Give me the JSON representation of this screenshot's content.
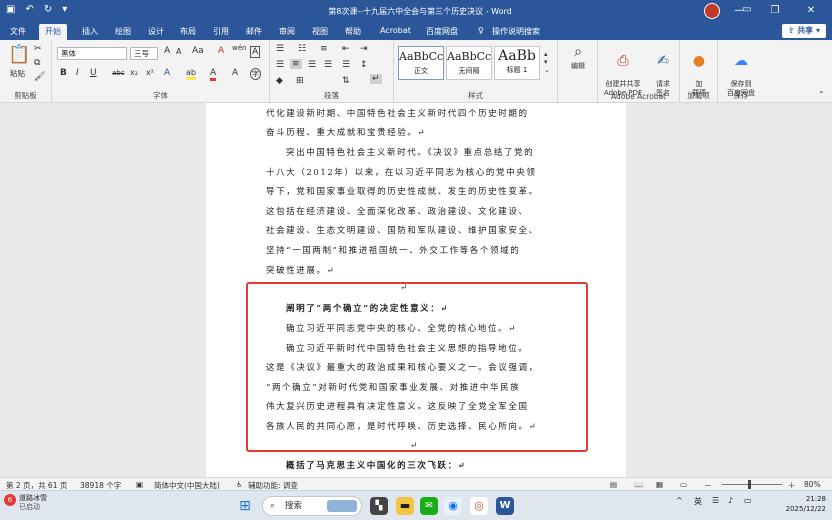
{
  "window": {
    "title": "第8次课--十九届六中全会与第三个历史决议 - Word",
    "controls": [
      "—",
      "❐",
      "✕"
    ]
  },
  "qat": {
    "save_icon": "save-icon",
    "undo": "↶",
    "redo": "↻",
    "more": "▾"
  },
  "tabs": [
    {
      "label": "文件"
    },
    {
      "label": "开始"
    },
    {
      "label": "插入"
    },
    {
      "label": "绘图"
    },
    {
      "label": "设计"
    },
    {
      "label": "布局"
    },
    {
      "label": "引用"
    },
    {
      "label": "邮件"
    },
    {
      "label": "审阅"
    },
    {
      "label": "视图"
    },
    {
      "label": "帮助"
    },
    {
      "label": "Acrobat"
    },
    {
      "label": "百度网盘"
    },
    {
      "label": "操作说明搜索"
    }
  ],
  "share": "共享",
  "ribbon": {
    "clipboard": {
      "paste": "粘贴",
      "label": "剪贴板"
    },
    "font": {
      "name": "黑体",
      "size": "三号",
      "label": "字体",
      "size_up": "A",
      "size_down": "A",
      "aa": "Aa",
      "clear": "A",
      "wen": "wén",
      "a_box": "A",
      "B": "B",
      "I": "I",
      "U": "U",
      "abc": "abc",
      "sub": "x₂",
      "sup": "x²",
      "effects": "A",
      "highlight": "ab",
      "color": "A",
      "a_circ": "A",
      "char_circle": "字"
    },
    "paragraph": {
      "label": "段落"
    },
    "styles": {
      "label": "样式",
      "items": [
        {
          "preview": "AaBbCc",
          "name": "正文"
        },
        {
          "preview": "AaBbCc",
          "name": "无间隔"
        },
        {
          "preview": "AaBb",
          "name": "标题 1"
        }
      ]
    },
    "editing": {
      "label": "编辑"
    },
    "acrobat": {
      "create": "创建并共享\nAdobe PDF",
      "request": "请求\n签名",
      "label": "Adobe Acrobat"
    },
    "addin": {
      "btn": "加\n载项",
      "label": "加载项"
    },
    "save": {
      "btn": "保存到\n百度网盘",
      "label": "保存"
    }
  },
  "document": {
    "lines": [
      "代化建设新时期、中国特色社会主义新时代四个历史时期的",
      "奋斗历程、重大成就和宝贵经验。↵",
      "突出中国特色社会主义新时代。《决议》重点总结了党的",
      "十八大（2012年）以来，在以习近平同志为核心的党中央领",
      "导下，党和国家事业取得的历史性成就、发生的历史性变革。",
      "这包括在经济建设、全面深化改革、政治建设、文化建设、",
      "社会建设、生态文明建设、国防和军队建设、维护国家安全、",
      "坚持“一国两制”和推进祖国统一、外交工作等各个领域的",
      "突破性进展。↵",
      "↵",
      "阐明了“两个确立”的决定性意义：↵",
      "确立习近平同志党中央的核心、全党的核心地位。↵",
      "确立习近平新时代中国特色社会主义思想的指导地位。",
      "这是《决议》最重大的政治成果和核心要义之一。会议强调，",
      "“两个确立”对新时代党和国家事业发展、对推进中华民族",
      "伟大复兴历史进程具有决定性意义。这反映了全党全军全国",
      "各族人民的共同心愿，是时代呼唤、历史选择、民心所向。↵",
      "↵",
      "概括了马克思主义中国化的三次飞跃：↵"
    ]
  },
  "status": {
    "page": "第 2 页，共 61 页",
    "words": "38918 个字",
    "lang": "简体中文(中国大陆)",
    "access": "辅助功能: 调查",
    "zoom": "80%",
    "zoom_minus": "－",
    "zoom_plus": "＋"
  },
  "taskbar": {
    "weather_badge": "6",
    "weather_title": "道路冰雪",
    "weather_sub": "已启动",
    "search": "搜索",
    "ime": "英",
    "time": "21:28",
    "date": "2025/12/22",
    "caret": "^"
  }
}
